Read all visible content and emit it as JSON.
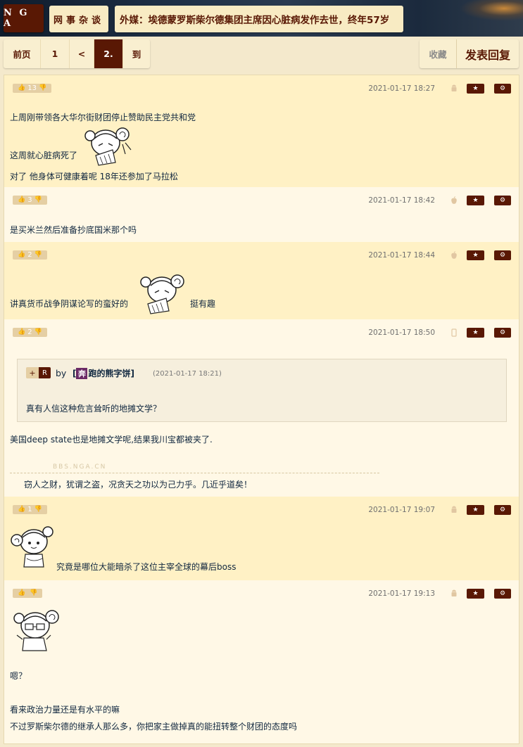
{
  "header": {
    "logo": "N G A",
    "forum": "网事杂谈",
    "thread_title": "外媒：埃德蒙罗斯柴尔德集团主席因心脏病发作去世，终年57岁"
  },
  "pager": {
    "items": [
      "前页",
      "1",
      "<",
      "2.",
      "到"
    ],
    "active_index": 3
  },
  "actions": {
    "favorite": "收藏",
    "reply": "发表回复"
  },
  "posts": [
    {
      "votes": "13",
      "time": "2021-01-17 18:27",
      "device": "android",
      "lines": [
        "上周刚带领各大华尔街财团停止赞助民主党共和党",
        "这周就心脏病死了",
        "对了 他身体可健康着呢 18年还参加了马拉松"
      ]
    },
    {
      "votes": "3",
      "time": "2021-01-17 18:42",
      "device": "apple",
      "lines": [
        "是买米兰然后准备抄底国米那个吗"
      ]
    },
    {
      "votes": "2",
      "time": "2021-01-17 18:44",
      "device": "apple",
      "lines": [
        "讲真货币战争阴谋论写的蛮好的",
        "挺有趣"
      ]
    },
    {
      "votes": "2",
      "time": "2021-01-17 18:50",
      "device": "mobile",
      "quote": {
        "plus": "+",
        "r": "R",
        "by": "by",
        "name_prefix": "[",
        "avatar_char": "奔",
        "name": "跑的熊字饼]",
        "time": "(2021-01-17 18:21)",
        "text": "真有人信这种危言耸听的地摊文学？"
      },
      "lines": [
        "美国deep state也是地摊文学呢,结果我川宝都被夹了."
      ],
      "signature_mark": "BBS.NGA.CN",
      "signature": "窃人之财，犹谓之盗，况贪天之功以为己力乎。几近乎道矣！"
    },
    {
      "votes": "1",
      "time": "2021-01-17 19:07",
      "device": "android",
      "lines": [
        "究竟是哪位大能暗杀了这位主宰全球的幕后boss"
      ]
    },
    {
      "votes": "",
      "time": "2021-01-17 19:13",
      "device": "android",
      "lines": [
        "嗯？",
        "看来政治力量还是有水平的嘛",
        "不过罗斯柴尔德的继承人那么多，你把家主做掉真的能扭转整个财团的态度吗"
      ]
    }
  ],
  "icons": {
    "thumb_up": "thumb-up-icon",
    "thumb_down": "thumb-down-icon",
    "star": "star-icon",
    "gear": "gear-icon"
  },
  "colors": {
    "brand": "#591804",
    "odd_row": "#fff1c5",
    "even_row": "#fff8e6",
    "text": "#10273f"
  }
}
